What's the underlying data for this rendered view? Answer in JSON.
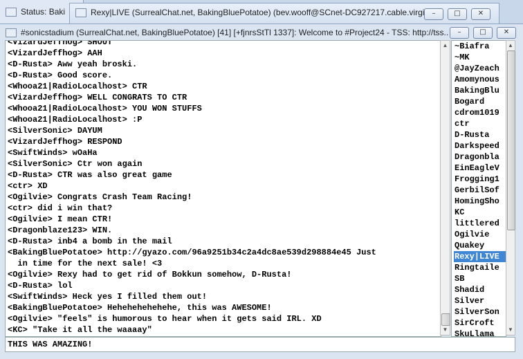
{
  "windows": {
    "status_title": "Status: Baki",
    "query_title": "Rexy|LIVE (SurrealChat.net, BakingBluePotatoe) (bev.wooff@SCnet-DC927217.cable.virginm",
    "channel_title": "#sonicstadium (SurrealChat.net, BakingBluePotatoe) [41] [+fjnrsStTl 1337]: Welcome to #Project24 - TSS: http://tss....",
    "controls": {
      "minimize": "–",
      "maximize": "□",
      "close": "✕"
    }
  },
  "chat": {
    "lines": [
      "<VizardJeffhog> SHOUT",
      "<VizardJeffhog> AAH",
      "<D-Rusta> Aww yeah broski.",
      "<D-Rusta> Good score.",
      "<Whooa21|RadioLocalhost> CTR",
      "<VizardJeffhog> WELL CONGRATS TO CTR",
      "<Whooa21|RadioLocalhost> YOU WON STUFFS",
      "<Whooa21|RadioLocalhost> :P",
      "<SilverSonic> DAYUM",
      "<VizardJeffhog> RESPOND",
      "<SwiftWinds> wOaHa",
      "<SilverSonic> Ctr won again",
      "<D-Rusta> CTR was also great game",
      "<ctr> XD",
      "<Ogilvie> Congrats Crash Team Racing!",
      "<ctr> did i win that?",
      "<Ogilvie> I mean CTR!",
      "<Dragonblaze123> WIN.",
      "<D-Rusta> inb4 a bomb in the mail",
      "<BakingBluePotatoe> http://gyazo.com/96a9251b34c2a4dc8ae539d298884e45 Just\n  in time for the next sale! <3",
      "<Ogilvie> Rexy had to get rid of Bokkun somehow, D-Rusta!",
      "<D-Rusta> lol",
      "<SwiftWinds> Heck yes I filled them out!",
      "<BakingBluePotatoe> Hehehehehehehe, this was AWESOME!",
      "<Ogilvie> \"feels\" is humorous to hear when it gets said IRL. XD",
      "<KC> \"Take it all the waaaay\""
    ]
  },
  "nicklist": {
    "items": [
      "~Biafra",
      "~MK",
      "@JayZeach",
      "Amomynous",
      "BakingBlu",
      "Bogard",
      "cdrom1019",
      "ctr",
      "D-Rusta",
      "Darkspeed",
      "Dragonbla",
      "EinEagleV",
      "Frogging1",
      "GerbilSof",
      "HomingSho",
      "KC",
      "littlered",
      "Ogilvie",
      "Quakey",
      "Rexy|LIVE",
      "Ringtaile",
      "SB",
      "Shadid",
      "Silver",
      "SilverSon",
      "SirCroft",
      "SkuLlama"
    ],
    "selected": "Rexy|LIVE"
  },
  "input": {
    "value": "THIS WAS AMAZING!"
  }
}
